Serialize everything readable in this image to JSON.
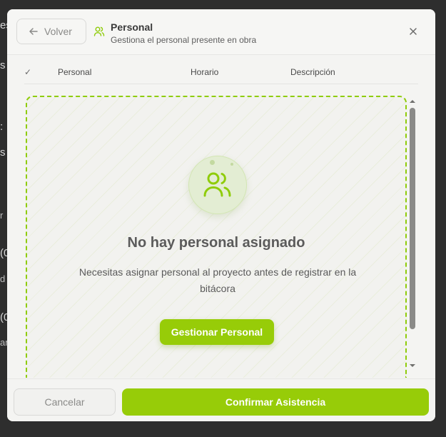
{
  "background": {
    "glyphs": [
      "es",
      "s",
      ":",
      "s",
      "r",
      "(0",
      "d",
      "(0",
      "ar"
    ]
  },
  "header": {
    "back_label": "Volver",
    "title": "Personal",
    "subtitle": "Gestiona el personal presente en obra"
  },
  "table": {
    "columns": [
      "✓",
      "Personal",
      "Horario",
      "Descripción"
    ]
  },
  "empty_state": {
    "title": "No hay personal asignado",
    "description": "Necesitas asignar personal al proyecto antes de registrar en la bitácora",
    "button_label": "Gestionar Personal"
  },
  "footer": {
    "cancel_label": "Cancelar",
    "confirm_label": "Confirmar Asistencia"
  },
  "colors": {
    "accent": "#97cc08",
    "dashed_border": "#8fcc0a"
  }
}
